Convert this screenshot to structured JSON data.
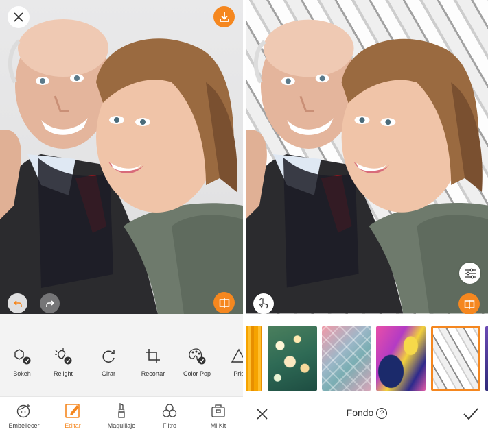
{
  "left_panel": {
    "tools": [
      {
        "label": "Bokeh",
        "icon": "bokeh-icon"
      },
      {
        "label": "Relight",
        "icon": "relight-icon"
      },
      {
        "label": "Girar",
        "icon": "rotate-icon"
      },
      {
        "label": "Recortar",
        "icon": "crop-icon"
      },
      {
        "label": "Color Pop",
        "icon": "color-pop-icon"
      },
      {
        "label": "Pris",
        "icon": "prism-icon"
      }
    ],
    "nav": [
      {
        "label": "Embellecer",
        "icon": "face-icon",
        "active": false
      },
      {
        "label": "Editar",
        "icon": "edit-icon",
        "active": true
      },
      {
        "label": "Maquillaje",
        "icon": "lipstick-icon",
        "active": false
      },
      {
        "label": "Filtro",
        "icon": "filter-icon",
        "active": false
      },
      {
        "label": "Mi Kit",
        "icon": "kit-icon",
        "active": false
      }
    ]
  },
  "right_panel": {
    "title": "Fondo",
    "help_symbol": "?",
    "backgrounds": [
      {
        "name": "orange-stripes"
      },
      {
        "name": "bokeh-lights"
      },
      {
        "name": "pastel-scales"
      },
      {
        "name": "paint-swirl"
      },
      {
        "name": "white-geometric",
        "selected": true
      },
      {
        "name": "purple"
      }
    ]
  },
  "colors": {
    "accent": "#f5871f",
    "toolbar_bg": "#f3f3f3",
    "text": "#333333"
  }
}
